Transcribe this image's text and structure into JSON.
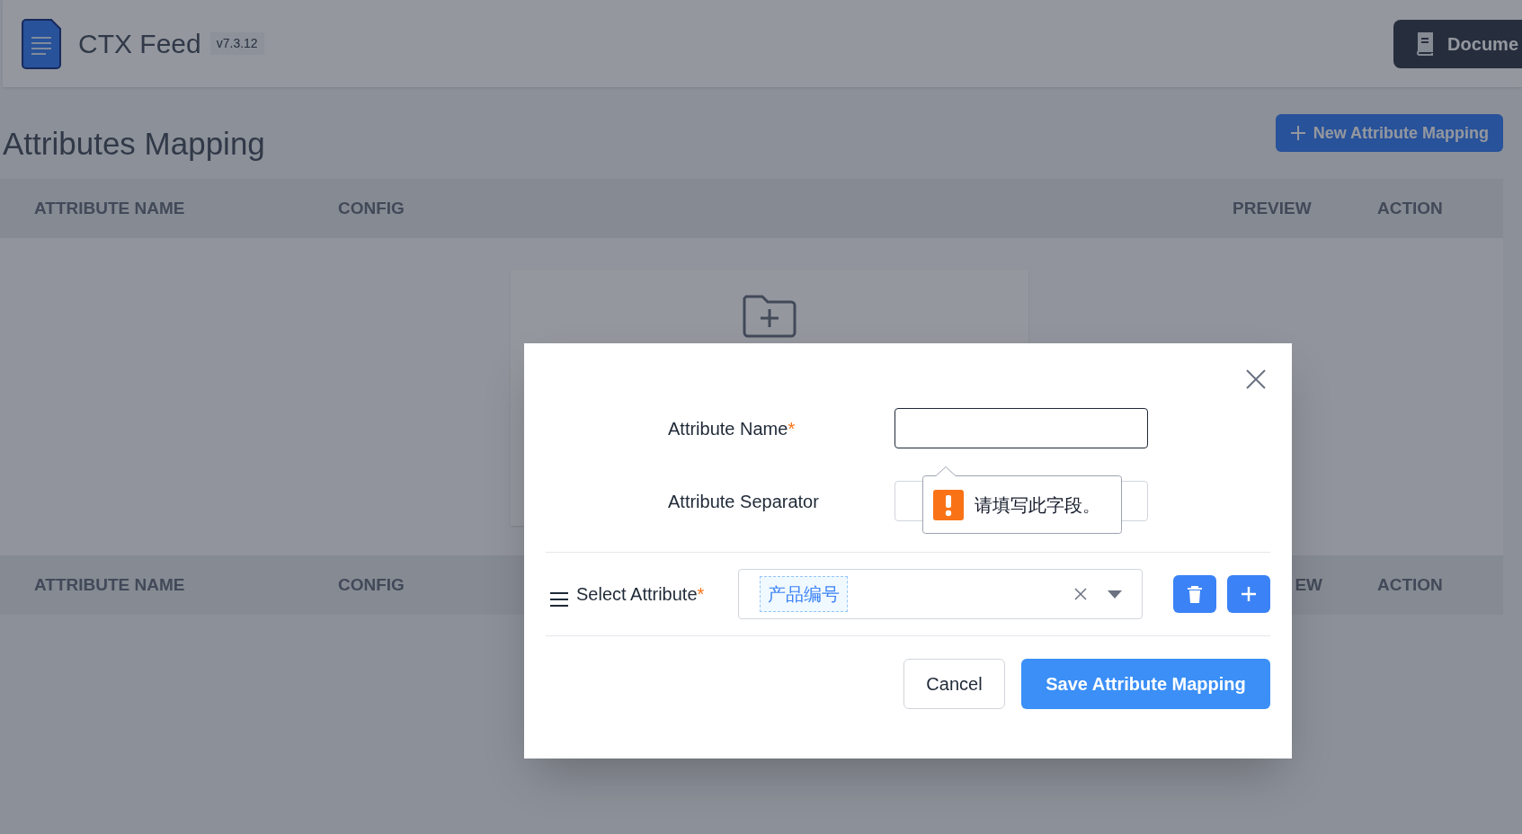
{
  "header": {
    "app_name": "CTX Feed",
    "version": "v7.3.12",
    "documentation_button": "Docume"
  },
  "page_title": "Attributes Mapping",
  "new_button": "New Attribute Mapping",
  "table": {
    "columns": [
      "ATTRIBUTE NAME",
      "CONFIG",
      "PREVIEW",
      "ACTION"
    ]
  },
  "table_footer": {
    "columns": [
      "ATTRIBUTE NAME",
      "CONFIG",
      "EW",
      "ACTION"
    ]
  },
  "modal": {
    "fields": [
      {
        "label": "Attribute Name",
        "required_mark": "*",
        "focused": true
      },
      {
        "label": "Attribute Separator",
        "focused": false
      }
    ],
    "validation_tooltip": "请填写此字段。",
    "select_attribute": {
      "label": "Select Attribute",
      "required_mark": "*",
      "tags": [
        "产品编号"
      ]
    },
    "buttons": [
      {
        "label": "Cancel",
        "kind": "secondary"
      },
      {
        "label": "Save Attribute Mapping",
        "kind": "primary"
      }
    ]
  }
}
